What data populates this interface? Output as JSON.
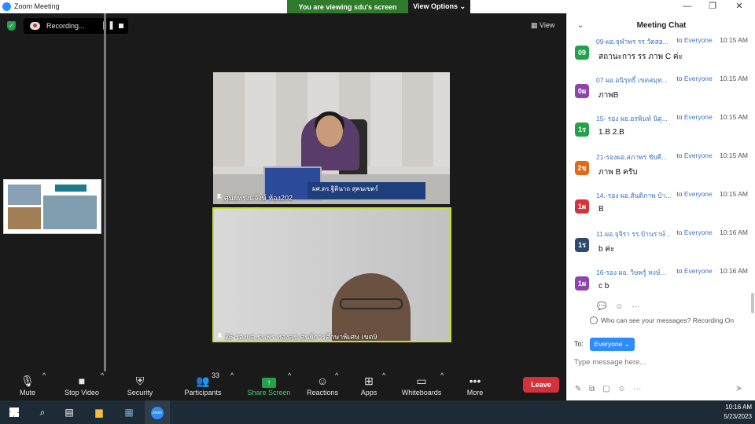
{
  "window": {
    "title": "Zoom Meeting"
  },
  "banner": {
    "viewing": "You are viewing sdu's screen",
    "options": "View Options"
  },
  "recording": {
    "label": "Recording..."
  },
  "view_button": "View",
  "tiles": {
    "top": {
      "name": "ศูนย์ทรงแจ้งษ์ ห้อง202",
      "nameplate": "ผศ.ดร.ฐิตินาถ สุคนเขตร์"
    },
    "bottom": {
      "name": "26-รองผอ.ธนพร ทองสุข ศูนย์การศึกษาพิเศษ เขต9"
    }
  },
  "toolbar": {
    "mute": "Mute",
    "stop_video": "Stop Video",
    "security": "Security",
    "participants": "Participants",
    "participants_count": "33",
    "share_screen": "Share Screen",
    "reactions": "Reactions",
    "apps": "Apps",
    "whiteboards": "Whiteboards",
    "more": "More",
    "leave": "Leave"
  },
  "chat": {
    "title": "Meeting Chat",
    "to_label": "to",
    "messages": [
      {
        "avatar": "09",
        "color": "#23a14b",
        "sender": "09-ผอ.จุฬาพร รร.วัดสอ...",
        "recipient": "Everyone",
        "time": "10:15 AM",
        "text": "สถานะการ รร ภาพ C ค่ะ"
      },
      {
        "avatar": "0ผ",
        "color": "#8e44ad",
        "sender": "07 ผอ.อนิรุทธิ์ เขตสมุท...",
        "recipient": "Everyone",
        "time": "10:15 AM",
        "text": "ภาพB"
      },
      {
        "avatar": "1ร",
        "color": "#23a14b",
        "sender": "15- รอง ผอ.อรพินท์ นิตุ...",
        "recipient": "Everyone",
        "time": "10:15 AM",
        "text": "1.B 2.B"
      },
      {
        "avatar": "2ช",
        "color": "#e06a18",
        "sender": "21-รองผอ.สภาพร ชัยคี...",
        "recipient": "Everyone",
        "time": "10:15 AM",
        "text": "ภาพ B ครับ"
      },
      {
        "avatar": "1ผ",
        "color": "#d6313b",
        "sender": "14.-รอง ผอ.สันติภาพ บ้า...",
        "recipient": "Everyone",
        "time": "10:15 AM",
        "text": "B"
      },
      {
        "avatar": "1ร",
        "color": "#2c4a6e",
        "sender": "11.ผอ.จุจิรา รร.บ้านราษ์...",
        "recipient": "Everyone",
        "time": "10:16 AM",
        "text": " b  ค่ะ"
      },
      {
        "avatar": "1ผ",
        "color": "#8e44ad",
        "sender": "16-รอง ผอ. วิษพรู้ หงษ์...",
        "recipient": "Everyone",
        "time": "10:16 AM",
        "text": "c b"
      }
    ],
    "privacy": "Who can see your messages? Recording On",
    "to": "To:",
    "to_target": "Everyone",
    "input_placeholder": "Type message here..."
  },
  "taskbar": {
    "time": "10:16 AM",
    "date": "5/23/2023"
  }
}
